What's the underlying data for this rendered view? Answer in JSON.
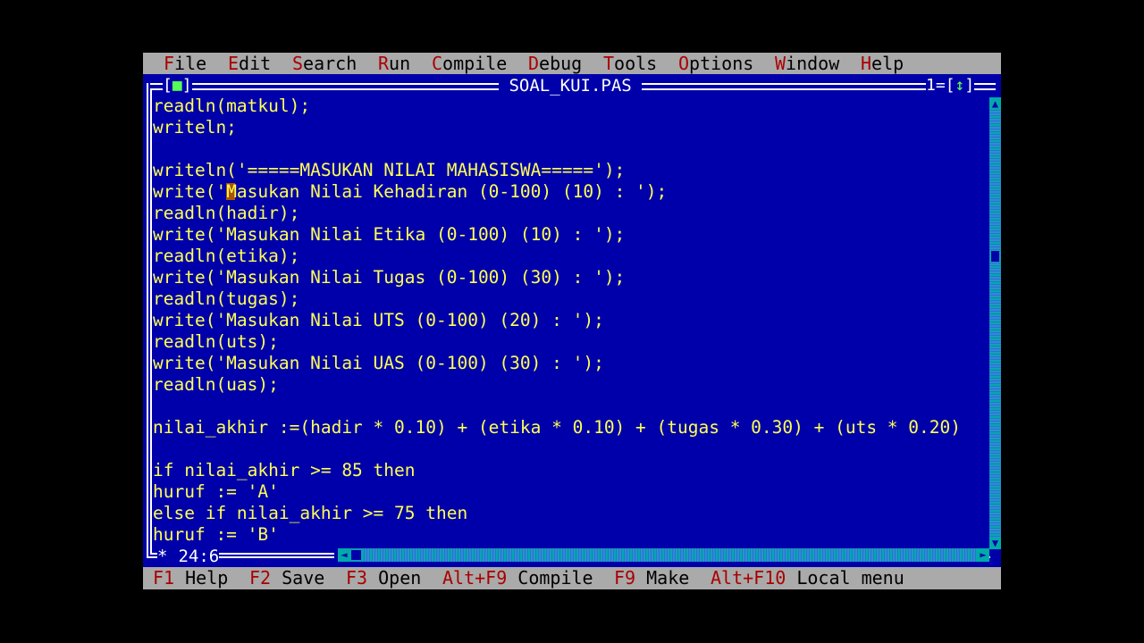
{
  "menu": [
    {
      "hot": "F",
      "rest": "ile"
    },
    {
      "hot": "E",
      "rest": "dit"
    },
    {
      "hot": "S",
      "rest": "earch"
    },
    {
      "hot": "R",
      "rest": "un"
    },
    {
      "hot": "C",
      "rest": "ompile"
    },
    {
      "hot": "D",
      "rest": "ebug"
    },
    {
      "hot": "T",
      "rest": "ools"
    },
    {
      "hot": "O",
      "rest": "ptions"
    },
    {
      "hot": "W",
      "rest": "indow"
    },
    {
      "hot": "H",
      "rest": "elp"
    }
  ],
  "window": {
    "title": " SOAL_KUI.PAS ",
    "close_box_left": "[",
    "close_box_mark": "■",
    "close_box_right": "]",
    "number": "1=",
    "zoom_box_left": "[",
    "zoom_box_mark": "↕",
    "zoom_box_right": "]",
    "cursor_position": "24:6",
    "modified_marker": "*"
  },
  "code": [
    "readln(matkul);",
    "writeln;",
    "",
    "writeln('=====MASUKAN NILAI MAHASISWA=====');",
    "write('Masukan Nilai Kehadiran (0-100) (10) : ');",
    "readln(hadir);",
    "write('Masukan Nilai Etika (0-100) (10) : ');",
    "readln(etika);",
    "write('Masukan Nilai Tugas (0-100) (30) : ');",
    "readln(tugas);",
    "write('Masukan Nilai UTS (0-100) (20) : ');",
    "readln(uts);",
    "write('Masukan Nilai UAS (0-100) (30) : ');",
    "readln(uas);",
    "",
    "nilai_akhir :=(hadir * 0.10) + (etika * 0.10) + (tugas * 0.30) + (uts * 0.20)",
    "",
    "if nilai_akhir >= 85 then",
    "huruf := 'A'",
    "else if nilai_akhir >= 75 then",
    "huruf := 'B'"
  ],
  "cursor": {
    "line": 4,
    "column": 7
  },
  "status": [
    {
      "key": "F1",
      "label": "Help"
    },
    {
      "key": "F2",
      "label": "Save"
    },
    {
      "key": "F3",
      "label": "Open"
    },
    {
      "key": "Alt+F9",
      "label": "Compile"
    },
    {
      "key": "F9",
      "label": "Make"
    },
    {
      "key": "Alt+F10",
      "label": "Local menu"
    }
  ],
  "colors": {
    "editor_bg": "#0000aa",
    "code_text": "#ffff55",
    "menu_bg": "#aaaaaa",
    "hotkey": "#aa0000",
    "scrollbar": "#00aaaa",
    "cursor": "#aa5500"
  },
  "icons": {
    "close_box": "close-box-icon",
    "zoom_box": "zoom-box-icon",
    "scroll_up": "arrow-up-icon",
    "scroll_down": "arrow-down-icon",
    "scroll_left": "arrow-left-icon",
    "scroll_right": "arrow-right-icon"
  },
  "glyphs": {
    "up": "▲",
    "down": "▼",
    "left": "◄",
    "right": "►"
  }
}
